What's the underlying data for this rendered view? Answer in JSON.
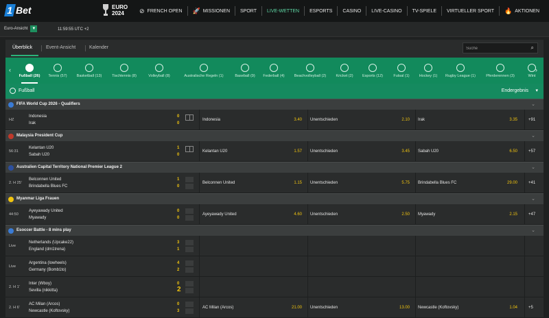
{
  "brand": {
    "one": "1",
    "bet": "Bet"
  },
  "euro": {
    "line1": "EURO",
    "line2": "2024"
  },
  "nav": [
    {
      "label": "FRENCH OPEN",
      "icon": "⊘",
      "live": false
    },
    {
      "label": "MISSIONEN",
      "icon": "🚀",
      "live": false
    },
    {
      "label": "SPORT",
      "icon": "",
      "live": false
    },
    {
      "label": "LIVE-WETTEN",
      "icon": "",
      "live": true
    },
    {
      "label": "ESPORTS",
      "icon": "",
      "live": false
    },
    {
      "label": "CASINO",
      "icon": "",
      "live": false
    },
    {
      "label": "LIVE-CASINO",
      "icon": "",
      "live": false
    },
    {
      "label": "TV-SPIELE",
      "icon": "",
      "live": false
    },
    {
      "label": "VIRTUELLER SPORT",
      "icon": "",
      "live": false
    },
    {
      "label": "AKTIONEN",
      "icon": "🔥",
      "live": false
    }
  ],
  "subbar": {
    "odds_view": "Euro-Ansicht",
    "clock": "11:59:55 UTC +2"
  },
  "tabs": {
    "overview": "Überblick",
    "event": "Event-Ansicht",
    "calendar": "Kalender"
  },
  "search": {
    "placeholder": "Suche"
  },
  "sports": [
    {
      "label": "Fußball (26)",
      "active": true
    },
    {
      "label": "Tennis (57)"
    },
    {
      "label": "Basketball (13)"
    },
    {
      "label": "Tischtennis (8)"
    },
    {
      "label": "Volleyball (8)"
    },
    {
      "label": "Australische Regeln (1)"
    },
    {
      "label": "Baseball (9)"
    },
    {
      "label": "Federball (4)"
    },
    {
      "label": "Beachvolleyball (2)"
    },
    {
      "label": "Kricket (2)"
    },
    {
      "label": "Esports (12)"
    },
    {
      "label": "Futsal (1)"
    },
    {
      "label": "Hockey (1)"
    },
    {
      "label": "Rugby League (1)"
    },
    {
      "label": "Pferderennen (3)"
    },
    {
      "label": "Wint"
    }
  ],
  "sport_header": {
    "title": "Fußball",
    "result": "Endergebnis"
  },
  "leagues": [
    {
      "name": "FIFA World Cup 2026 - Qualifiers",
      "flag": "#3a7bd5",
      "matches": [
        {
          "time": "HZ",
          "home": "Indonesia",
          "away": "Irak",
          "hs": "0",
          "as": "0",
          "o1n": "Indonesia",
          "o1": "3.40",
          "oxn": "Unentschieden",
          "ox": "2.10",
          "o2n": "Irak",
          "o2": "3.35",
          "more": "+91"
        }
      ]
    },
    {
      "name": "Malaysia President Cup",
      "flag": "#c0392b",
      "matches": [
        {
          "time": "56:31",
          "home": "Kelantan U20",
          "away": "Sabah U20",
          "hs": "1",
          "as": "0",
          "o1n": "Kelantan U20",
          "o1": "1.57",
          "oxn": "Unentschieden",
          "ox": "3.45",
          "o2n": "Sabah U20",
          "o2": "6.50",
          "more": "+57"
        }
      ]
    },
    {
      "name": "Australien Capital Territory National Premier League 2",
      "flag": "#2c4f9e",
      "matches": [
        {
          "time": "2. H 25'",
          "home": "Belconnen United",
          "away": "Brindabella Blues FC",
          "hs": "1",
          "as": "0",
          "o1n": "Belconnen United",
          "o1": "1.15",
          "oxn": "Unentschieden",
          "ox": "5.75",
          "o2n": "Brindabella Blues FC",
          "o2": "29.00",
          "more": "+41"
        }
      ]
    },
    {
      "name": "Myanmar Liga Frauen",
      "flag": "#f1c40f",
      "matches": [
        {
          "time": "44:50",
          "home": "Ayeyawady United",
          "away": "Myawady",
          "hs": "0",
          "as": "0",
          "o1n": "Ayeyawady United",
          "o1": "4.60",
          "oxn": "Unentschieden",
          "ox": "2.50",
          "o2n": "Myawady",
          "o2": "2.15",
          "more": "+47"
        }
      ]
    },
    {
      "name": "Esoccer Battle - 8 mins play",
      "flag": "#3a7bd5",
      "matches": [
        {
          "time": "Live",
          "home": "Netherlands (Upcake22)",
          "away": "England (dm1trena)",
          "hs": "3",
          "as": "1"
        },
        {
          "time": "Live",
          "home": "Argentina (lowheels)",
          "away": "Germany (Bomb1to)",
          "hs": "4",
          "as": "2"
        },
        {
          "time": "2. H 1'",
          "home": "Inter (Wboy)",
          "away": "Sevilla (nikkitta)",
          "hs": "0",
          "as": "2"
        },
        {
          "time": "2. H 6'",
          "home": "AC Milan (Arcos)",
          "away": "Newcastle (Koftovsky)",
          "hs": "0",
          "as": "3",
          "o1n": "AC Milan (Arcos)",
          "o1": "21.00",
          "oxn": "Unentschieden",
          "ox": "13.00",
          "o2n": "Newcastle (Koftovsky)",
          "o2": "1.04",
          "more": "+5"
        }
      ]
    }
  ]
}
